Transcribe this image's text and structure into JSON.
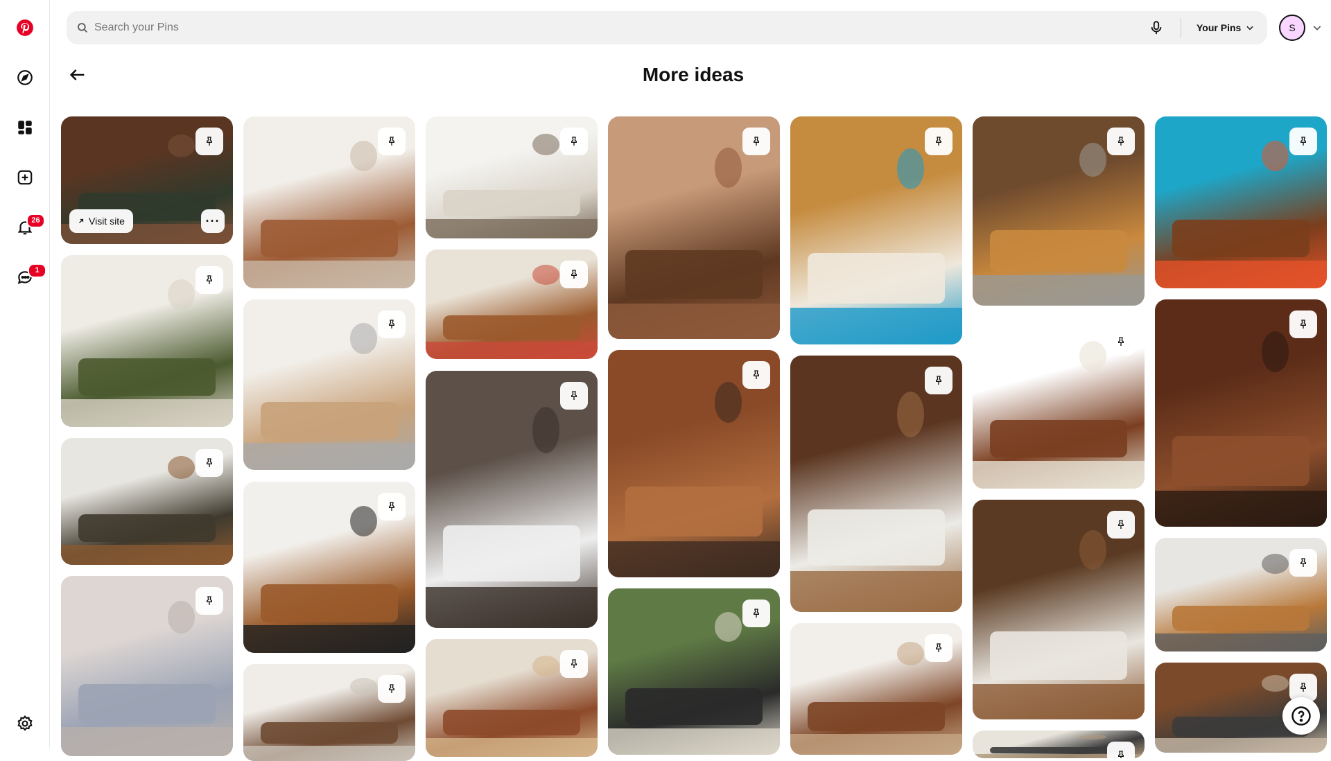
{
  "rail": {
    "notifications_count": "26",
    "messages_count": "1"
  },
  "search": {
    "placeholder": "Search your Pins"
  },
  "header": {
    "your_pins_label": "Your Pins",
    "avatar_initial": "S"
  },
  "page": {
    "title": "More ideas"
  },
  "overlay": {
    "visit_site_label": "Visit site",
    "more_label": "···"
  },
  "colors": {
    "brand_red": "#e60023",
    "search_bg": "#f1f1f1",
    "avatar_bg": "#f9d6ff"
  },
  "pins": [
    {
      "topic": "walnut paneled wall with dark green sofa",
      "colors": [
        "#5a3522",
        "#2f3a2c",
        "#7a5038"
      ]
    },
    {
      "topic": "green velvet sectional in white paneled room",
      "colors": [
        "#efece5",
        "#4b5a2f",
        "#d8d2c4"
      ]
    },
    {
      "topic": "sunroom living room with leather sofa",
      "colors": [
        "#e8e6e0",
        "#3f3a2e",
        "#8a5a32"
      ]
    },
    {
      "topic": "grey sofa with pendant light",
      "colors": [
        "#ddd6d3",
        "#9ba3b4",
        "#b9b0ab"
      ]
    },
    {
      "topic": "leather sofa with wooden side table",
      "colors": [
        "#f2efea",
        "#9c5b34",
        "#c9b8a6"
      ]
    },
    {
      "topic": "round dining table with gallery wall",
      "colors": [
        "#f2efea",
        "#c8a27a",
        "#aaaaaa"
      ]
    },
    {
      "topic": "walnut media console with TV",
      "colors": [
        "#f2f0ec",
        "#9a5a2a",
        "#222222"
      ]
    },
    {
      "topic": "wood ceiling room with globe pendant",
      "colors": [
        "#f0ede8",
        "#6e4a32",
        "#c9c2b8"
      ]
    },
    {
      "topic": "bright living room with grand piano",
      "colors": [
        "#f4f3f0",
        "#d9d3c8",
        "#7b6c5b"
      ]
    },
    {
      "topic": "walnut kitchen cabinetry",
      "colors": [
        "#e9e2d6",
        "#9b5a2c",
        "#c94a3a"
      ]
    },
    {
      "topic": "dining room with tulip table and brick wall",
      "colors": [
        "#5c5048",
        "#eeeeee",
        "#3a2f29"
      ]
    },
    {
      "topic": "abstract art above credenza",
      "colors": [
        "#e5ddd0",
        "#8d4a2a",
        "#d5b48a"
      ]
    },
    {
      "topic": "wood ceiling living room with orb lamp",
      "colors": [
        "#c79a79",
        "#5e3820",
        "#8f5a3c"
      ]
    },
    {
      "topic": "library living room with bookshelves",
      "colors": [
        "#8a4a28",
        "#b36f3f",
        "#3d2a20"
      ]
    },
    {
      "topic": "glass wall room with Eames lounge chair",
      "colors": [
        "#5f7a45",
        "#2a2a2a",
        "#dcd7c9"
      ]
    },
    {
      "topic": "sputnik chandelier living room",
      "colors": [
        "#c58b3e",
        "#efe8dc",
        "#1e9ac8"
      ]
    },
    {
      "topic": "dining nook with paper lantern",
      "colors": [
        "#5b3520",
        "#ecebe6",
        "#9a6b43"
      ]
    },
    {
      "topic": "walnut kitchen with linear pendant",
      "colors": [
        "#f2efea",
        "#7d4526",
        "#c4a585"
      ]
    },
    {
      "topic": "wood paneled lounge with orange sofa",
      "colors": [
        "#6f4b2e",
        "#c9893e",
        "#9a9994"
      ]
    },
    {
      "topic": "walnut dining set with bench",
      "colors": [
        "#ffffff",
        "#7a3e20",
        "#e8e2d4"
      ]
    },
    {
      "topic": "living room with hanging fireplace",
      "colors": [
        "#5a3a22",
        "#e9e6df",
        "#8b5a34"
      ]
    },
    {
      "topic": "modern room partial",
      "colors": [
        "#e8e4dc",
        "#3b3b3b",
        "#b29a7c"
      ]
    },
    {
      "topic": "mondrian wall with orange sofa",
      "colors": [
        "#1ea6c8",
        "#7b3e1c",
        "#e5532a"
      ]
    },
    {
      "topic": "walnut stair wall with shelves",
      "colors": [
        "#5c2c18",
        "#8d4f2c",
        "#2b1a12"
      ]
    },
    {
      "topic": "loft with cognac leather sofa",
      "colors": [
        "#e8e6e2",
        "#b8783a",
        "#5f5f5f"
      ]
    },
    {
      "topic": "library loft with wood ceiling",
      "colors": [
        "#7a4a2a",
        "#3b3b3b",
        "#c9b9a6"
      ]
    }
  ]
}
